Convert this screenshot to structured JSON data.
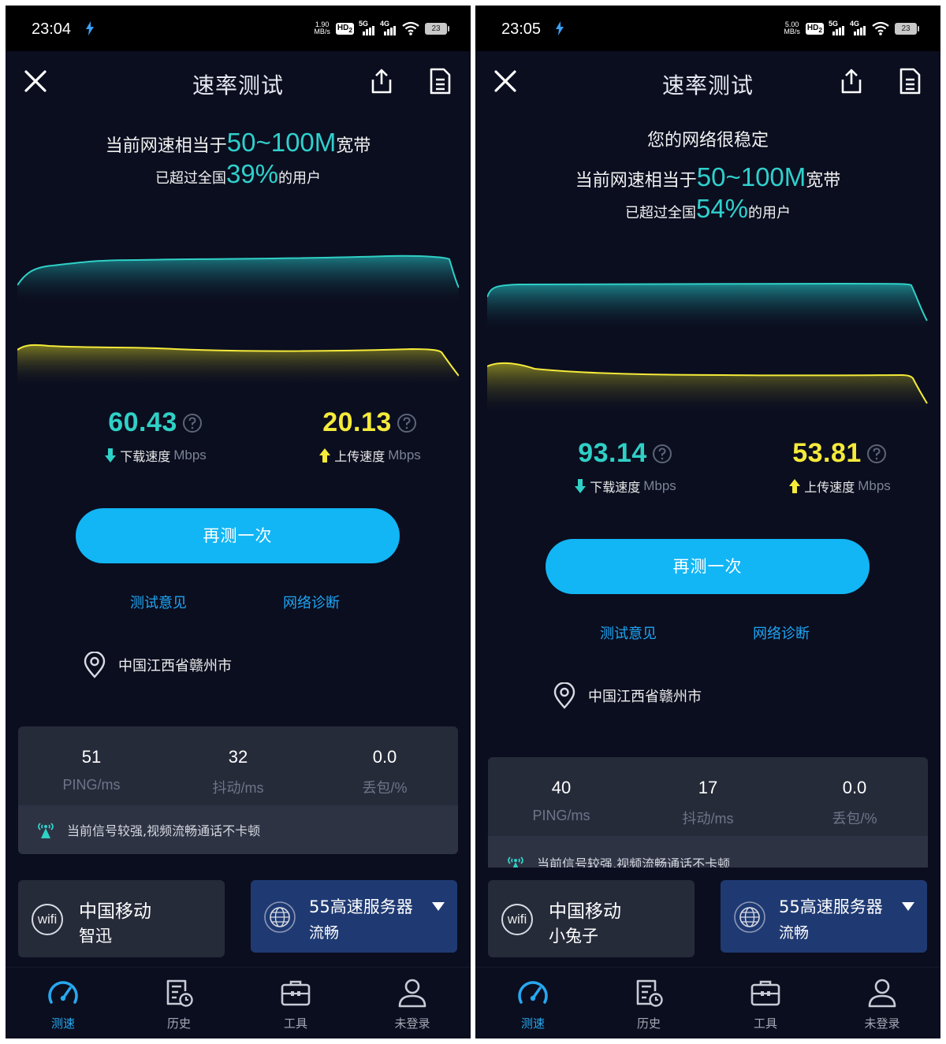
{
  "screens": [
    {
      "status": {
        "time": "23:04",
        "netspeed_value": "1.90",
        "netspeed_unit": "MB/s",
        "hd": "HD",
        "hd_sub": "2",
        "sig1": "5G",
        "sig2": "4G",
        "battery": "23"
      },
      "title": "速率测试",
      "stable_message": "",
      "equiv_prefix": "当前网速相当于",
      "equiv_value": "50~100M",
      "equiv_suffix": "宽带",
      "exceed_prefix": "已超过全国",
      "exceed_value": "39%",
      "exceed_suffix": "的用户",
      "download": {
        "value": "60.43",
        "label": "下载速度",
        "unit": "Mbps"
      },
      "upload": {
        "value": "20.13",
        "label": "上传速度",
        "unit": "Mbps"
      },
      "retest_label": "再测一次",
      "feedback_link": "测试意见",
      "diagnose_link": "网络诊断",
      "location": "中国江西省赣州市",
      "stats": [
        {
          "value": "51",
          "label": "PING/ms"
        },
        {
          "value": "32",
          "label": "抖动/ms"
        },
        {
          "value": "0.0",
          "label": "丢包/%"
        }
      ],
      "signal_message": "当前信号较强,视频流畅通话不卡顿",
      "wifi": {
        "badge": "wifi",
        "isp": "中国移动",
        "ssid": "智迅"
      },
      "server": {
        "name": "55高速服务器",
        "status": "流畅"
      },
      "tabs": [
        "测速",
        "历史",
        "工具",
        "未登录"
      ]
    },
    {
      "status": {
        "time": "23:05",
        "netspeed_value": "5.00",
        "netspeed_unit": "MB/s",
        "hd": "HD",
        "hd_sub": "2",
        "sig1": "5G",
        "sig2": "4G",
        "battery": "23"
      },
      "title": "速率测试",
      "stable_message": "您的网络很稳定",
      "equiv_prefix": "当前网速相当于",
      "equiv_value": "50~100M",
      "equiv_suffix": "宽带",
      "exceed_prefix": "已超过全国",
      "exceed_value": "54%",
      "exceed_suffix": "的用户",
      "download": {
        "value": "93.14",
        "label": "下载速度",
        "unit": "Mbps"
      },
      "upload": {
        "value": "53.81",
        "label": "上传速度",
        "unit": "Mbps"
      },
      "retest_label": "再测一次",
      "feedback_link": "测试意见",
      "diagnose_link": "网络诊断",
      "location": "中国江西省赣州市",
      "stats": [
        {
          "value": "40",
          "label": "PING/ms"
        },
        {
          "value": "17",
          "label": "抖动/ms"
        },
        {
          "value": "0.0",
          "label": "丢包/%"
        }
      ],
      "signal_message": "当前信号较强,视频流畅通话不卡顿",
      "wifi": {
        "badge": "wifi",
        "isp": "中国移动",
        "ssid": "小兔子"
      },
      "server": {
        "name": "55高速服务器",
        "status": "流畅"
      },
      "tabs": [
        "测速",
        "历史",
        "工具",
        "未登录"
      ]
    }
  ],
  "colors": {
    "background": "#0b0e1f",
    "download_accent": "#2fd0c6",
    "upload_accent": "#f5ea3a",
    "button": "#12b6f5",
    "link": "#1ea6f5",
    "card": "#262b3a",
    "server_card": "#1f3a73",
    "tab_active": "#28a8f0"
  }
}
